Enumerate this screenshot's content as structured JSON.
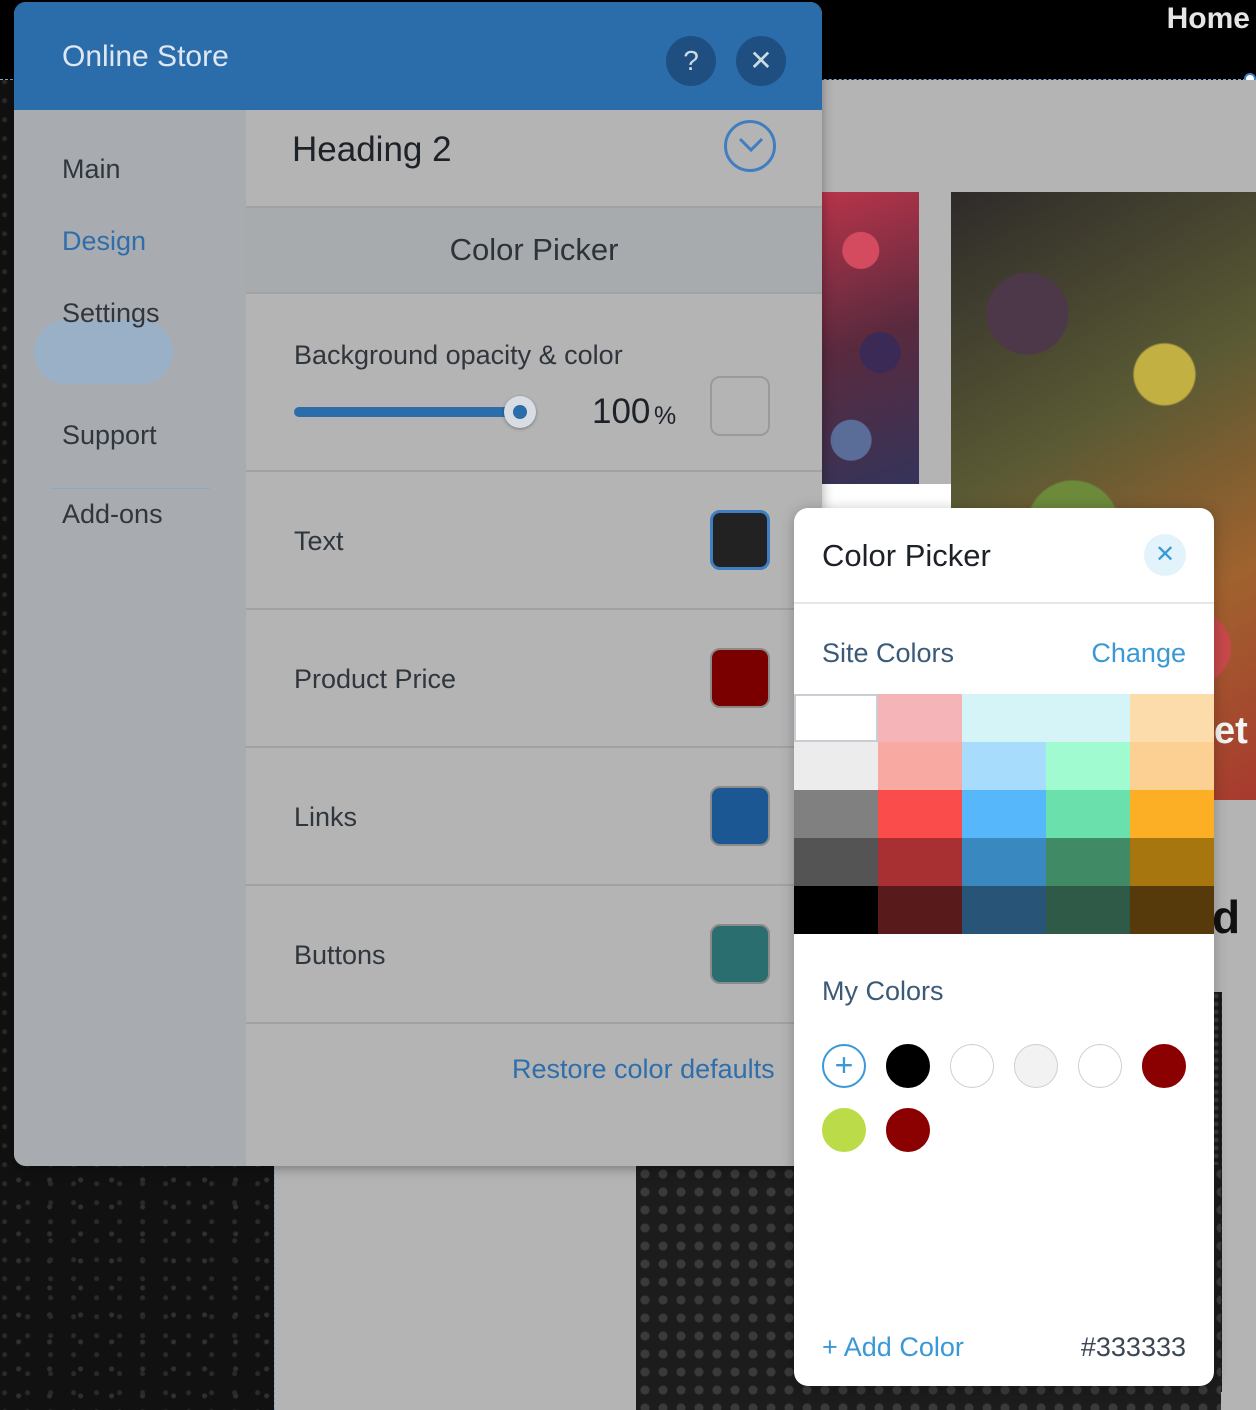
{
  "site": {
    "nav_home": "Home",
    "heading_fragment_1": "et",
    "heading_fragment_2": "d"
  },
  "panel": {
    "title": "Online Store",
    "help_icon": "?",
    "close_icon": "✕",
    "sidebar": {
      "items": [
        {
          "label": "Main"
        },
        {
          "label": "Design",
          "active": true
        },
        {
          "label": "Settings"
        },
        {
          "label": "Support"
        },
        {
          "label": "Add-ons"
        }
      ]
    },
    "section_title": "Heading 2",
    "subheader": "Color Picker",
    "background": {
      "label": "Background opacity & color",
      "opacity_value": "100",
      "opacity_unit": "%",
      "opacity_fraction": 1.0,
      "swatch_color": "#b4b4b4"
    },
    "rows": [
      {
        "label": "Text",
        "color": "#222222",
        "selected": true
      },
      {
        "label": "Product Price",
        "color": "#7a0000"
      },
      {
        "label": "Links",
        "color": "#1b5893"
      },
      {
        "label": "Buttons",
        "color": "#2a6e70"
      }
    ],
    "restore_label": "Restore color defaults"
  },
  "picker": {
    "title": "Color Picker",
    "close_icon": "✕",
    "site_colors_label": "Site Colors",
    "change_label": "Change",
    "palette": [
      [
        "#ffffff",
        "#f5b4b8",
        "#d5f4f7",
        "#d5f4f7",
        "#fbdcaa"
      ],
      [
        "#ececec",
        "#f8aaa2",
        "#a7dcfd",
        "#a0fcd0",
        "#fbd092"
      ],
      [
        "#808080",
        "#fb4c4c",
        "#56b8fb",
        "#6ae0ac",
        "#fcaf25"
      ],
      [
        "#545454",
        "#a83032",
        "#3a88c0",
        "#418a66",
        "#a8760f"
      ],
      [
        "#000000",
        "#581a1a",
        "#285478",
        "#2f5a48",
        "#573a0c"
      ]
    ],
    "my_colors_label": "My Colors",
    "add_icon": "+",
    "my_colors": [
      "#000000",
      "#ffffff",
      "#f2f2f2",
      "#ffffff",
      "#8b0000",
      "#bbdb48",
      "#8b0000"
    ],
    "add_color_label": "+ Add Color",
    "hex_value": "#333333"
  }
}
